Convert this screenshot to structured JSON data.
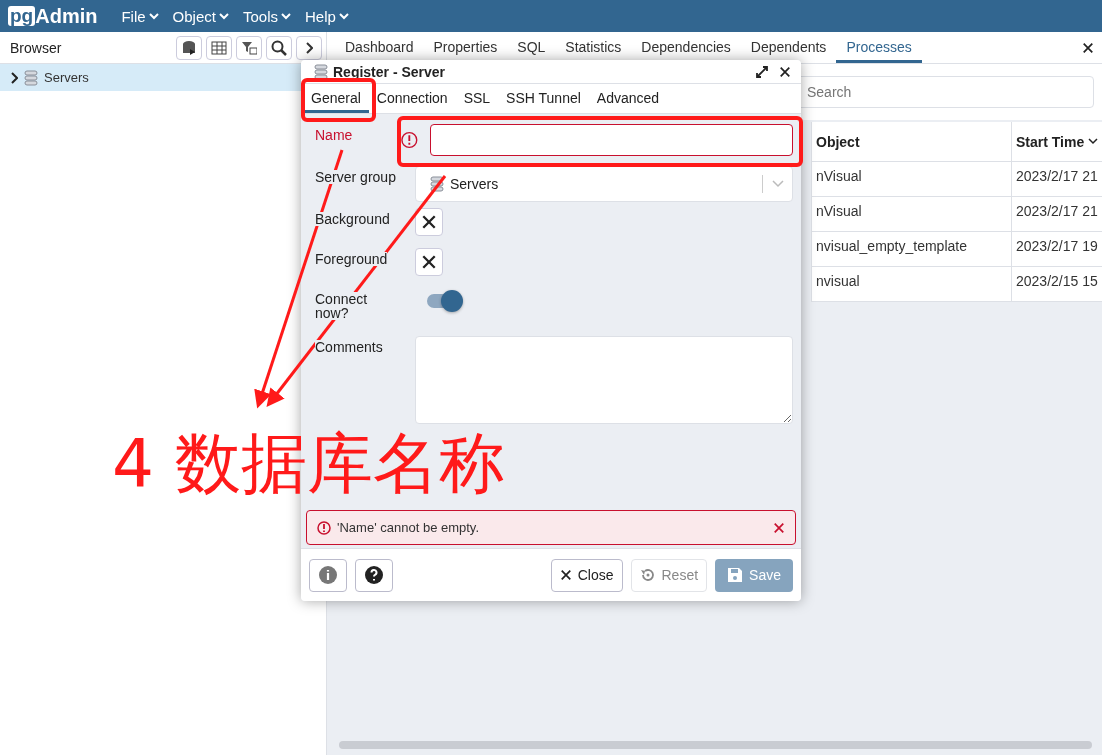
{
  "navbar": {
    "logo_prefix": "pg",
    "logo_suffix": "Admin",
    "menus": [
      "File",
      "Object",
      "Tools",
      "Help"
    ]
  },
  "browser": {
    "title": "Browser",
    "tree": [
      {
        "label": "Servers",
        "expanded": false,
        "selected": true
      }
    ]
  },
  "main_tabs": [
    {
      "label": "Dashboard",
      "selected": false
    },
    {
      "label": "Properties",
      "selected": false
    },
    {
      "label": "SQL",
      "selected": false
    },
    {
      "label": "Statistics",
      "selected": false
    },
    {
      "label": "Dependencies",
      "selected": false
    },
    {
      "label": "Dependents",
      "selected": false
    },
    {
      "label": "Processes",
      "selected": true
    }
  ],
  "search": {
    "placeholder": "Search"
  },
  "table": {
    "columns": [
      {
        "label": "Object",
        "sorted": false
      },
      {
        "label": "Start Time",
        "sorted": true
      }
    ],
    "rows": [
      [
        "nVisual",
        "2023/2/17 21"
      ],
      [
        "nVisual",
        "2023/2/17 21"
      ],
      [
        "nvisual_empty_template",
        "2023/2/17 19"
      ],
      [
        "nvisual",
        "2023/2/15 15"
      ]
    ]
  },
  "dialog": {
    "title": "Register - Server",
    "tabs": [
      {
        "label": "General",
        "selected": true
      },
      {
        "label": "Connection",
        "selected": false
      },
      {
        "label": "SSL",
        "selected": false
      },
      {
        "label": "SSH Tunnel",
        "selected": false
      },
      {
        "label": "Advanced",
        "selected": false
      }
    ],
    "fields": [
      {
        "kind": "text",
        "label": "Name",
        "error": true
      },
      {
        "kind": "select",
        "label": "Server group",
        "value": "Servers",
        "error": false
      },
      {
        "kind": "color",
        "label": "Background",
        "error": false
      },
      {
        "kind": "color",
        "label": "Foreground",
        "error": false
      },
      {
        "kind": "switch",
        "label": "Connect now?",
        "on": true,
        "error": false
      },
      {
        "kind": "textarea",
        "label": "Comments",
        "error": false
      }
    ],
    "error_message": "'Name' cannot be empty.",
    "buttons": {
      "close": {
        "label": "Close",
        "disabled": false
      },
      "reset": {
        "label": "Reset",
        "disabled": true
      },
      "save": {
        "label": "Save",
        "disabled": true
      }
    }
  },
  "annotation": {
    "label": "4 数据库名称"
  }
}
